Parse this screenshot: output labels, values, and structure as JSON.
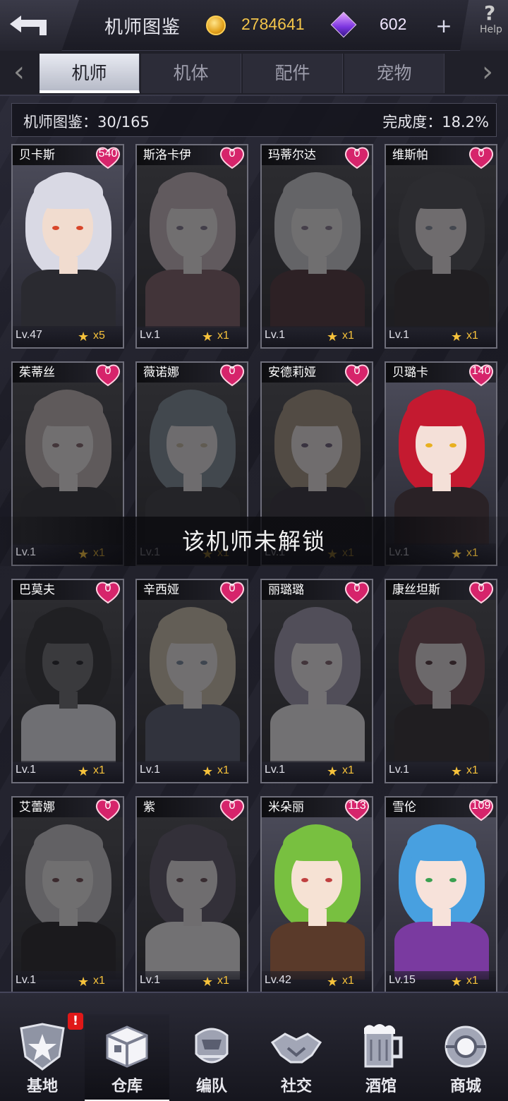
{
  "header": {
    "title": "机师图鉴",
    "gold": "2784641",
    "gems": "602",
    "plus": "+",
    "help_mark": "?",
    "help_text": "Help"
  },
  "tabs": [
    {
      "label": "机师",
      "active": true
    },
    {
      "label": "机体",
      "active": false
    },
    {
      "label": "配件",
      "active": false
    },
    {
      "label": "宠物",
      "active": false
    }
  ],
  "stats": {
    "collection": "机师图鉴：30/165",
    "completion": "完成度：18.2%"
  },
  "pilots": [
    {
      "name": "贝卡斯",
      "affection": "540",
      "level": "Lv.47",
      "stars": "x5",
      "locked": false
    },
    {
      "name": "斯洛卡伊",
      "affection": "0",
      "level": "Lv.1",
      "stars": "x1",
      "locked": true
    },
    {
      "name": "玛蒂尔达",
      "affection": "0",
      "level": "Lv.1",
      "stars": "x1",
      "locked": true
    },
    {
      "name": "维斯帕",
      "affection": "0",
      "level": "Lv.1",
      "stars": "x1",
      "locked": true
    },
    {
      "name": "茱蒂丝",
      "affection": "0",
      "level": "Lv.1",
      "stars": "x1",
      "locked": true
    },
    {
      "name": "薇诺娜",
      "affection": "0",
      "level": "Lv.1",
      "stars": "x1",
      "locked": true
    },
    {
      "name": "安德莉娅",
      "affection": "0",
      "level": "Lv.1",
      "stars": "x1",
      "locked": true
    },
    {
      "name": "贝璐卡",
      "affection": "140",
      "level": "Lv.1",
      "stars": "x1",
      "locked": false
    },
    {
      "name": "巴莫夫",
      "affection": "0",
      "level": "Lv.1",
      "stars": "x1",
      "locked": true
    },
    {
      "name": "辛西娅",
      "affection": "0",
      "level": "Lv.1",
      "stars": "x1",
      "locked": true
    },
    {
      "name": "丽璐璐",
      "affection": "0",
      "level": "Lv.1",
      "stars": "x1",
      "locked": true
    },
    {
      "name": "康丝坦斯",
      "affection": "0",
      "level": "Lv.1",
      "stars": "x1",
      "locked": true
    },
    {
      "name": "艾蕾娜",
      "affection": "0",
      "level": "Lv.1",
      "stars": "x1",
      "locked": true
    },
    {
      "name": "紫",
      "affection": "0",
      "level": "Lv.1",
      "stars": "x1",
      "locked": true
    },
    {
      "name": "米朵丽",
      "affection": "113",
      "level": "Lv.42",
      "stars": "x1",
      "locked": false
    },
    {
      "name": "雪伦",
      "affection": "109",
      "level": "Lv.15",
      "stars": "x1",
      "locked": false
    }
  ],
  "toast": "该机师未解锁",
  "bottom_nav": [
    {
      "label": "基地",
      "icon": "base-icon",
      "badge": "!"
    },
    {
      "label": "仓库",
      "icon": "warehouse-icon",
      "active": true
    },
    {
      "label": "编队",
      "icon": "formation-icon"
    },
    {
      "label": "社交",
      "icon": "handshake-icon"
    },
    {
      "label": "酒馆",
      "icon": "tavern-icon"
    },
    {
      "label": "商城",
      "icon": "shop-icon"
    }
  ],
  "colors": {
    "gold": "#f3c54a",
    "heart": "#d6246b",
    "star": "#f6c23b",
    "tab_active": "#e8eaf2"
  }
}
